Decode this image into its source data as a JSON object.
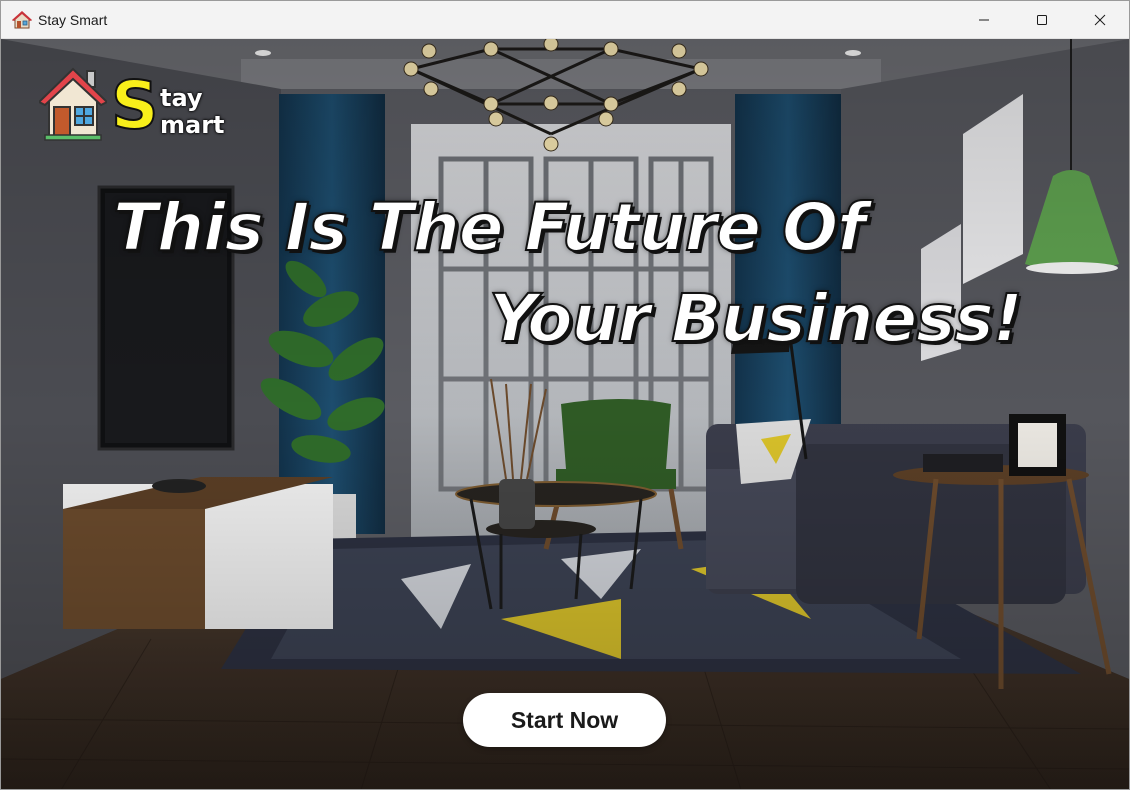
{
  "window": {
    "title": "Stay Smart",
    "app_icon": "house-icon",
    "controls": [
      "minimize-icon",
      "maximize-icon",
      "close-icon"
    ]
  },
  "logo": {
    "big_letter": "S",
    "line1": "tay",
    "line2": "mart",
    "icon": "house-icon",
    "accent_color": "#f8ef1a"
  },
  "headline": {
    "line1": "This Is The Future Of",
    "line2": "Your Business!"
  },
  "cta": {
    "label": "Start Now"
  },
  "background": {
    "description_icon": "living-room-photo"
  }
}
